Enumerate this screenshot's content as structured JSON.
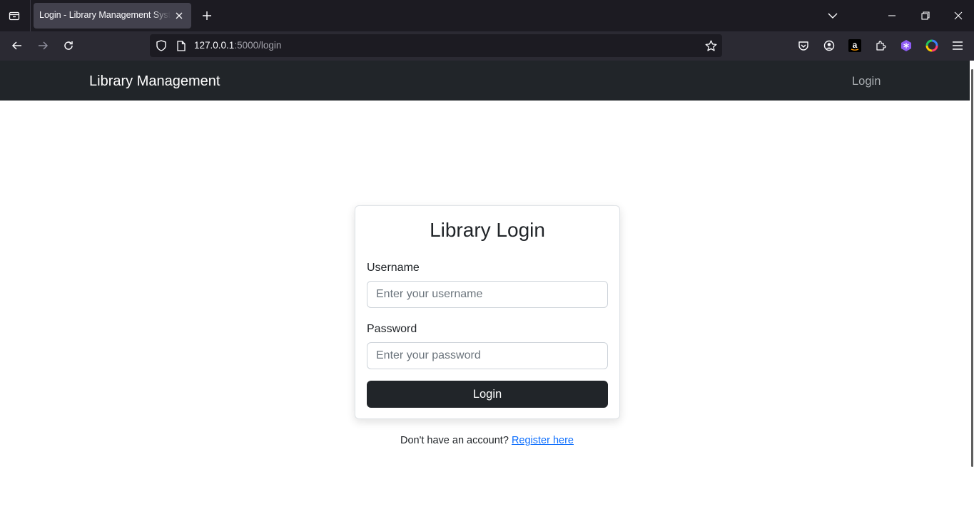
{
  "browser": {
    "tab_title": "Login - Library Management System",
    "url_host": "127.0.0.1",
    "url_path": ":5000/login"
  },
  "site": {
    "brand": "Library Management",
    "nav_login": "Login"
  },
  "login_card": {
    "title": "Library Login",
    "username_label": "Username",
    "username_placeholder": "Enter your username",
    "username_value": "",
    "password_label": "Password",
    "password_placeholder": "Enter your password",
    "password_value": "",
    "submit_label": "Login"
  },
  "register": {
    "prompt": "Don't have an account?",
    "link_text": "Register here"
  },
  "colors": {
    "navbar_bg": "#212529",
    "button_bg": "#212529",
    "link": "#0d6efd",
    "browser_tabstrip": "#1c1b22",
    "browser_toolbar": "#2b2a33"
  },
  "icons": {
    "tab_list": "tab-list-icon",
    "close_tab": "close-icon",
    "new_tab": "plus-icon",
    "list_all_tabs": "chevron-down-icon",
    "minimize": "minimize-icon",
    "restore": "restore-icon",
    "close_window": "close-icon",
    "back": "back-arrow-icon",
    "forward": "forward-arrow-icon",
    "reload": "reload-icon",
    "tracking_protection": "shield-icon",
    "page_info": "page-icon",
    "bookmark": "star-icon",
    "pocket": "pocket-icon",
    "account": "account-icon",
    "amazon": "amazon-icon",
    "extensions": "puzzle-icon",
    "extension_purple": "extension-icon",
    "colorzilla": "color-ring-icon",
    "menu": "hamburger-menu-icon"
  }
}
